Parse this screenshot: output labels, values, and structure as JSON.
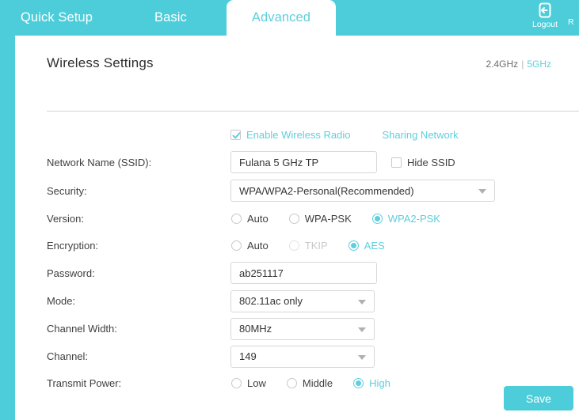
{
  "header": {
    "tabs": [
      {
        "label": "Quick Setup",
        "active": false
      },
      {
        "label": "Basic",
        "active": false
      },
      {
        "label": "Advanced",
        "active": true
      }
    ],
    "actions": [
      {
        "label": "Logout",
        "icon": "logout-icon"
      },
      {
        "label": "R",
        "icon": "reboot-icon"
      }
    ]
  },
  "page": {
    "title": "Wireless Settings",
    "band_24": "2.4GHz",
    "band_sep": "|",
    "band_5": "5GHz"
  },
  "form": {
    "enable_radio": {
      "label": "Enable Wireless Radio",
      "checked": true
    },
    "sharing_network": "Sharing Network",
    "ssid": {
      "label": "Network Name (SSID):",
      "value": "Fulana 5 GHz TP",
      "placeholder": ""
    },
    "hide_ssid": {
      "label": "Hide SSID",
      "checked": false
    },
    "security": {
      "label": "Security:",
      "value": "WPA/WPA2-Personal(Recommended)"
    },
    "version": {
      "label": "Version:",
      "options": [
        {
          "label": "Auto",
          "selected": false,
          "disabled": false
        },
        {
          "label": "WPA-PSK",
          "selected": false,
          "disabled": false
        },
        {
          "label": "WPA2-PSK",
          "selected": true,
          "disabled": false
        }
      ]
    },
    "encryption": {
      "label": "Encryption:",
      "options": [
        {
          "label": "Auto",
          "selected": false,
          "disabled": false
        },
        {
          "label": "TKIP",
          "selected": false,
          "disabled": true
        },
        {
          "label": "AES",
          "selected": true,
          "disabled": false
        }
      ]
    },
    "password": {
      "label": "Password:",
      "value": "ab251117",
      "placeholder": ""
    },
    "mode": {
      "label": "Mode:",
      "value": "802.11ac only"
    },
    "channel_width": {
      "label": "Channel Width:",
      "value": "80MHz"
    },
    "channel": {
      "label": "Channel:",
      "value": "149"
    },
    "transmit_power": {
      "label": "Transmit Power:",
      "options": [
        {
          "label": "Low",
          "selected": false,
          "disabled": false
        },
        {
          "label": "Middle",
          "selected": false,
          "disabled": false
        },
        {
          "label": "High",
          "selected": true,
          "disabled": false
        }
      ]
    },
    "save_label": "Save"
  },
  "colors": {
    "accent": "#4dcdd9",
    "accent_text": "#5ecfdc",
    "text": "#3f3f3f",
    "border": "#d8d8d8",
    "disabled": "#c9c9c9"
  }
}
